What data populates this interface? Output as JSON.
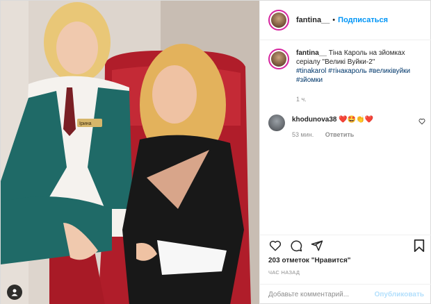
{
  "header": {
    "username": "fantina__",
    "separator": "•",
    "follow_label": "Подписаться"
  },
  "caption": {
    "username": "fantina__",
    "text": "Тіна Кароль на зйомках серіалу \"Великі Вуйки-2\"",
    "hashtags": [
      "#tinakarol",
      "#тінакароль",
      "#великівуйки",
      "#зйомки"
    ],
    "time": "1 ч."
  },
  "photo": {
    "badge_text": "Ірина"
  },
  "comment": {
    "username": "khodunova38",
    "emoji": "❤️🤩👏❤️",
    "time": "53 мин.",
    "reply_label": "Ответить"
  },
  "likes": {
    "text": "203 отметок \"Нравится\""
  },
  "timeago": "ЧАС НАЗАД",
  "add_comment": {
    "placeholder": "Добавьте комментарий...",
    "publish_label": "Опубликовать"
  },
  "colors": {
    "accent": "#0095f6",
    "publish_disabled": "#b2dffc",
    "muted": "#8e8e8e",
    "heart": "#ed4956"
  },
  "icons": [
    "user-tag-icon",
    "heart-icon",
    "comment-icon",
    "share-icon",
    "bookmark-icon",
    "small-heart-icon"
  ]
}
